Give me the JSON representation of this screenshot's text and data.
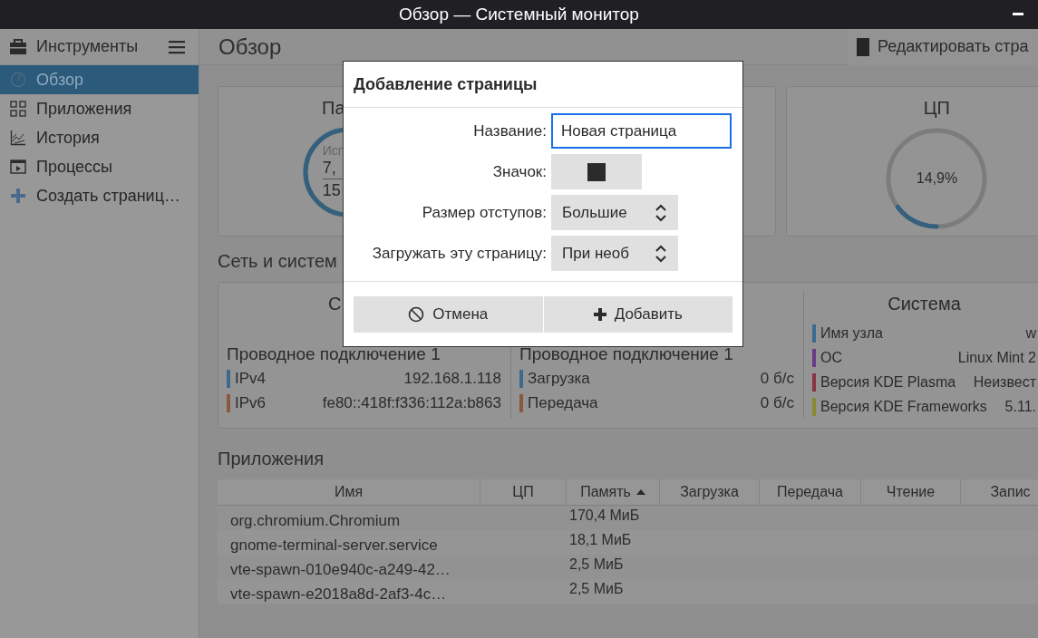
{
  "window": {
    "title": "Обзор — Системный монитор"
  },
  "sidebar": {
    "title": "Инструменты",
    "items": [
      {
        "label": "Обзор",
        "selected": true
      },
      {
        "label": "Приложения",
        "selected": false
      },
      {
        "label": "История",
        "selected": false
      },
      {
        "label": "Процессы",
        "selected": false
      },
      {
        "label": "Создать страниц…",
        "selected": false
      }
    ]
  },
  "page": {
    "title": "Обзор",
    "edit_button": "Редактировать стра"
  },
  "cards": [
    {
      "kind": "memory",
      "title": "Па",
      "lines": [
        "Исп",
        "7,",
        "15"
      ],
      "level": 0.5
    },
    {
      "kind": "empty"
    },
    {
      "kind": "cpu",
      "title": "ЦП",
      "reading": "14,9%",
      "level": 0.149
    }
  ],
  "network": {
    "title": "Сеть и систем",
    "columns": [
      {
        "title": "С",
        "connection": "Проводное подключение 1",
        "rows": [
          {
            "label": "IPv4",
            "value": "192.168.1.118",
            "color": "#3d6a8c"
          },
          {
            "label": "IPv6",
            "value": "fe80::418f:f336:112a:b863",
            "color": "#8a583a"
          }
        ]
      },
      {
        "connection": "Проводное подключение 1",
        "rows": [
          {
            "label": "Загрузка",
            "value": "0 б/с",
            "color": "#3d6a8c"
          },
          {
            "label": "Передача",
            "value": "0 б/с",
            "color": "#8a583a"
          }
        ]
      }
    ],
    "system": {
      "title": "Система",
      "rows": [
        {
          "label": "Имя узла",
          "value": "w",
          "color": "#3d6a8c"
        },
        {
          "label": "ОС",
          "value": "Linux Mint 2",
          "color": "#6a3a86"
        },
        {
          "label": "Версия KDE Plasma",
          "value": "Неизвест",
          "color": "#8a3344"
        },
        {
          "label": "Версия KDE Frameworks",
          "value": "5.11.",
          "color": "#8a8a2e"
        }
      ]
    }
  },
  "applications": {
    "title": "Приложения",
    "columns": [
      {
        "label": "Имя",
        "sorted": false
      },
      {
        "label": "ЦП",
        "sorted": false
      },
      {
        "label": "Память",
        "sorted": true
      },
      {
        "label": "Загрузка",
        "sorted": false
      },
      {
        "label": "Передача",
        "sorted": false
      },
      {
        "label": "Чтение",
        "sorted": false
      },
      {
        "label": "Запис",
        "sorted": false
      }
    ],
    "rows": [
      {
        "name": "org.chromium.Chromium",
        "memory": "170,4 МиБ"
      },
      {
        "name": "gnome-terminal-server.service",
        "memory": "18,1 МиБ"
      },
      {
        "name": "vte-spawn-010e940c-a249-42…",
        "memory": "2,5 МиБ"
      },
      {
        "name": "vte-spawn-e2018a8d-2af3-4c…",
        "memory": "2,5 МиБ"
      }
    ]
  },
  "dialog": {
    "title": "Добавление страницы",
    "fields": [
      {
        "kind": "text",
        "label": "Название:",
        "value": "Новая страница",
        "focused": true
      },
      {
        "kind": "icon",
        "label": "Значок:",
        "focused": false
      },
      {
        "kind": "combo",
        "label": "Размер отступов:",
        "value": "Большие",
        "focused": false
      },
      {
        "kind": "combo",
        "label": "Загружать эту страницу:",
        "value": "При необ",
        "focused": false
      }
    ],
    "buttons": [
      {
        "kind": "cancel",
        "label": "Отмена"
      },
      {
        "kind": "add",
        "label": "Добавить"
      }
    ]
  }
}
